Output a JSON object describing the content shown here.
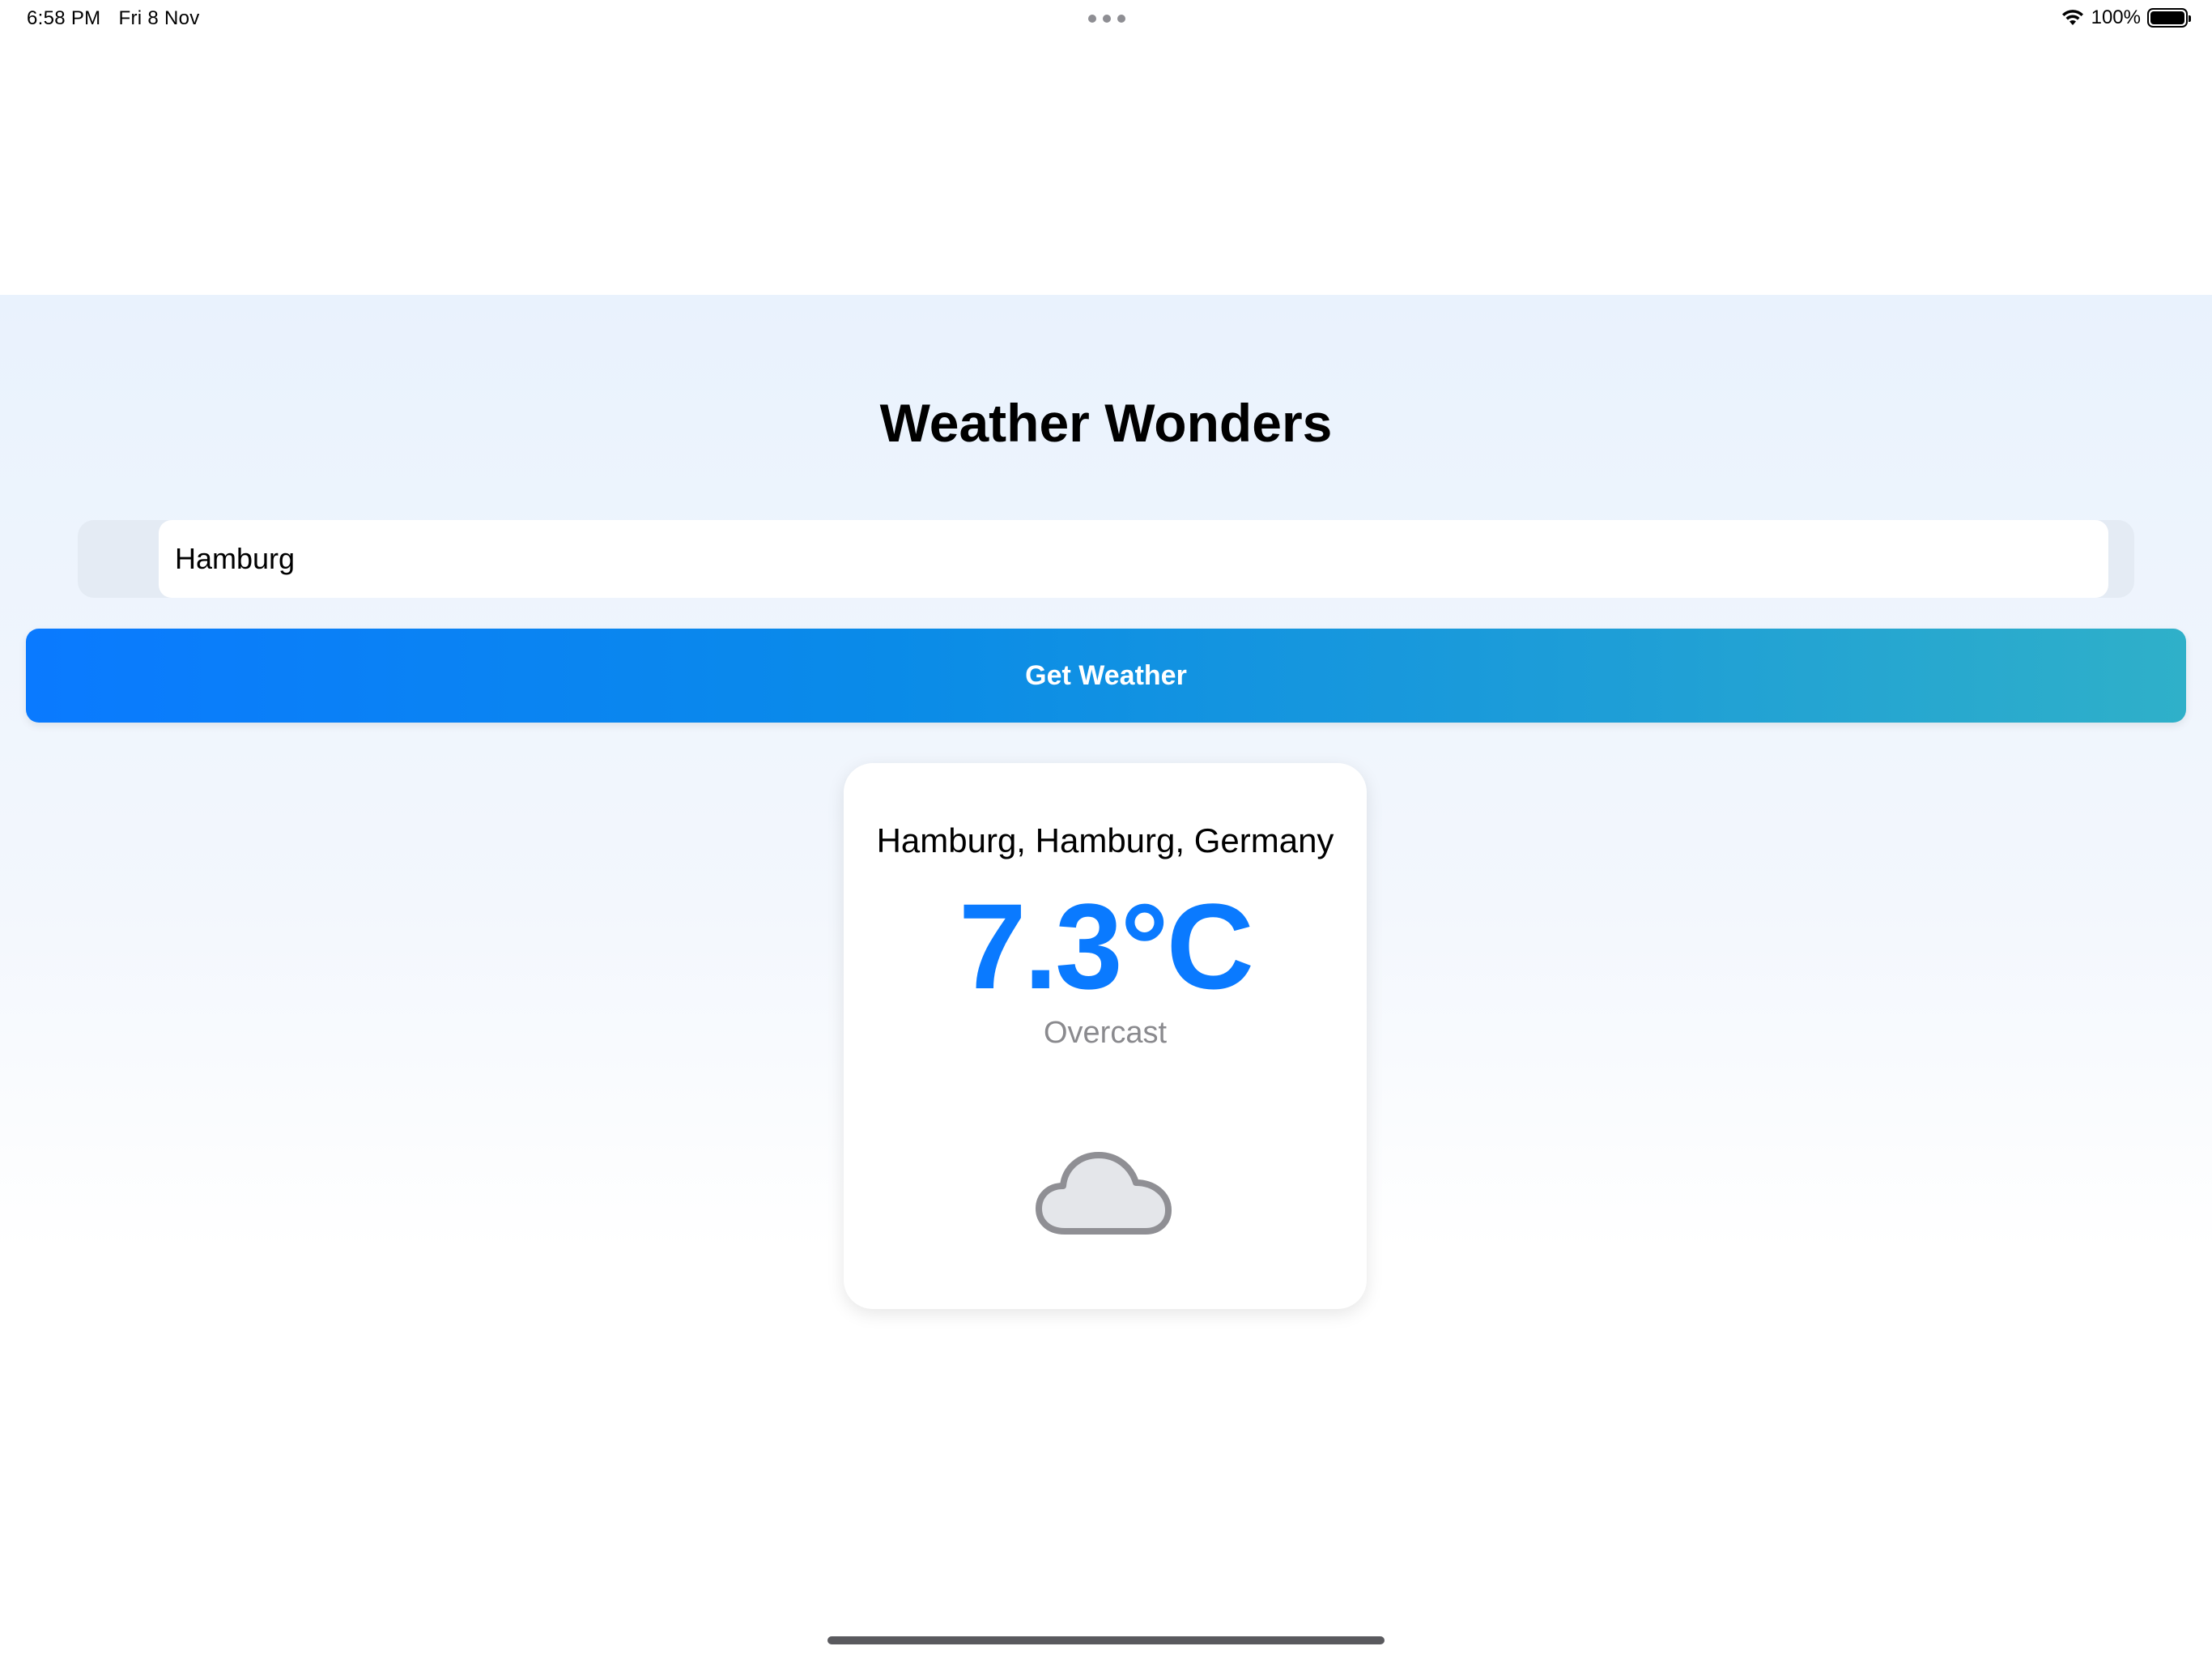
{
  "status_bar": {
    "time": "6:58 PM",
    "date": "Fri 8 Nov",
    "battery": "100%",
    "icons": [
      "wifi-icon",
      "battery-icon",
      "multitask-dots-icon"
    ]
  },
  "app": {
    "title": "Weather Wonders"
  },
  "search": {
    "value": "Hamburg",
    "icon": "search-icon"
  },
  "actions": {
    "get_weather_label": "Get Weather"
  },
  "weather": {
    "location": "Hamburg, Hamburg, Germany",
    "temperature": "7.3°C",
    "condition": "Overcast",
    "icon": "cloud-icon"
  },
  "colors": {
    "accent": "#0a7aff",
    "button_gradient_start": "#0a7aff",
    "button_gradient_end": "#2fb0c9",
    "condition_text": "#8a8a8e"
  }
}
